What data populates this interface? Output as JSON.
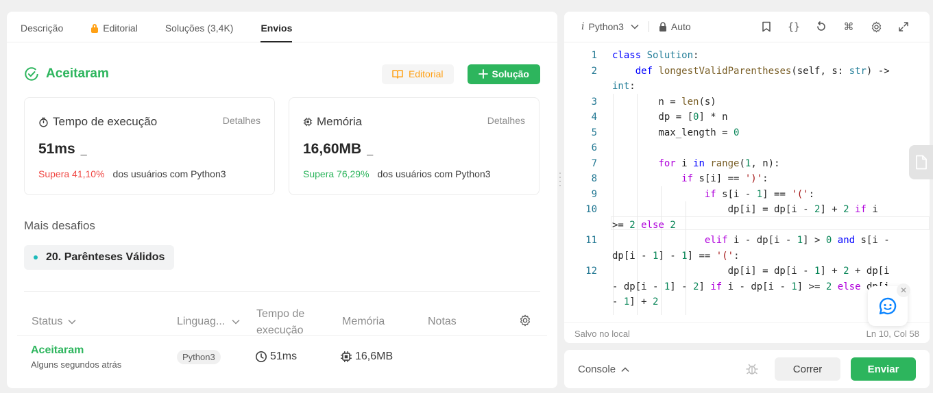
{
  "tabs": [
    {
      "label": "Descrição"
    },
    {
      "label": "Editorial"
    },
    {
      "label": "Soluções (3,4K)"
    },
    {
      "label": "Envios"
    }
  ],
  "result": {
    "status": "Aceitaram",
    "editorial_btn": "Editorial",
    "solution_btn": "Solução"
  },
  "runtime": {
    "title": "Tempo de execução",
    "detail": "Detalhes",
    "value": "51ms",
    "dash": "_",
    "beats": "Supera 41,10%",
    "suffix": "dos usuários com Python3"
  },
  "memory": {
    "title": "Memória",
    "detail": "Detalhes",
    "value": "16,60MB",
    "dash": "_",
    "beats": "Supera 76,29%",
    "suffix": "dos usuários com Python3"
  },
  "more": {
    "title": "Mais desafios",
    "chip": "20. Parênteses Válidos"
  },
  "table": {
    "headers": {
      "status": "Status",
      "language": "Linguag...",
      "runtime_1": "Tempo de",
      "runtime_2": "execução",
      "memory": "Memória",
      "notes": "Notas"
    },
    "row": {
      "status": "Aceitaram",
      "time_ago": "Alguns segundos atrás",
      "language": "Python3",
      "runtime": "51ms",
      "memory": "16,6MB"
    }
  },
  "editor": {
    "language": "Python3",
    "mode": "Auto",
    "saved": "Salvo no local",
    "position": "Ln 10, Col 58",
    "line_numbers": [
      "1",
      "2",
      "",
      "3",
      "4",
      "5",
      "6",
      "7",
      "8",
      "9",
      "10",
      "",
      "11",
      "",
      "12",
      "",
      "",
      ""
    ]
  },
  "console": {
    "label": "Console",
    "run": "Correr",
    "submit": "Enviar"
  },
  "colors": {
    "accent_green": "#2db55d",
    "accent_orange": "#ffa116",
    "beats_red": "#ef4743"
  }
}
